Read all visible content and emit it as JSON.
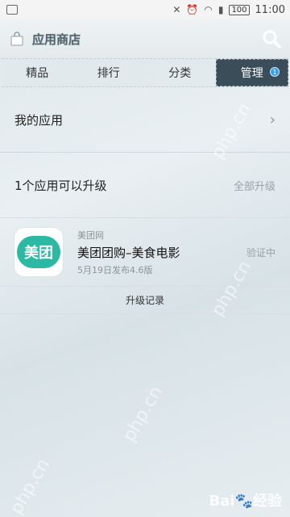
{
  "status_bar": {
    "time": "11:00",
    "battery": "100"
  },
  "header": {
    "title": "应用商店"
  },
  "tabs": [
    {
      "label": "精品"
    },
    {
      "label": "排行"
    },
    {
      "label": "分类"
    },
    {
      "label": "管理",
      "badge": "1"
    }
  ],
  "my_apps": {
    "label": "我的应用"
  },
  "upgrade": {
    "heading": "1个应用可以升级",
    "all_label": "全部升级",
    "app": {
      "icon_text": "美团",
      "vendor": "美团网",
      "name": "美团团购–美食电影",
      "release": "5月19日发布4.6版",
      "status": "验证中"
    },
    "history_label": "升级记录"
  },
  "watermark": {
    "text": "php.cn",
    "brand": "Bai🐾经验"
  },
  "colors": {
    "active_tab": "#3a4d59",
    "app_icon": "#2bb9a3",
    "badge": "#3a9ee6"
  }
}
